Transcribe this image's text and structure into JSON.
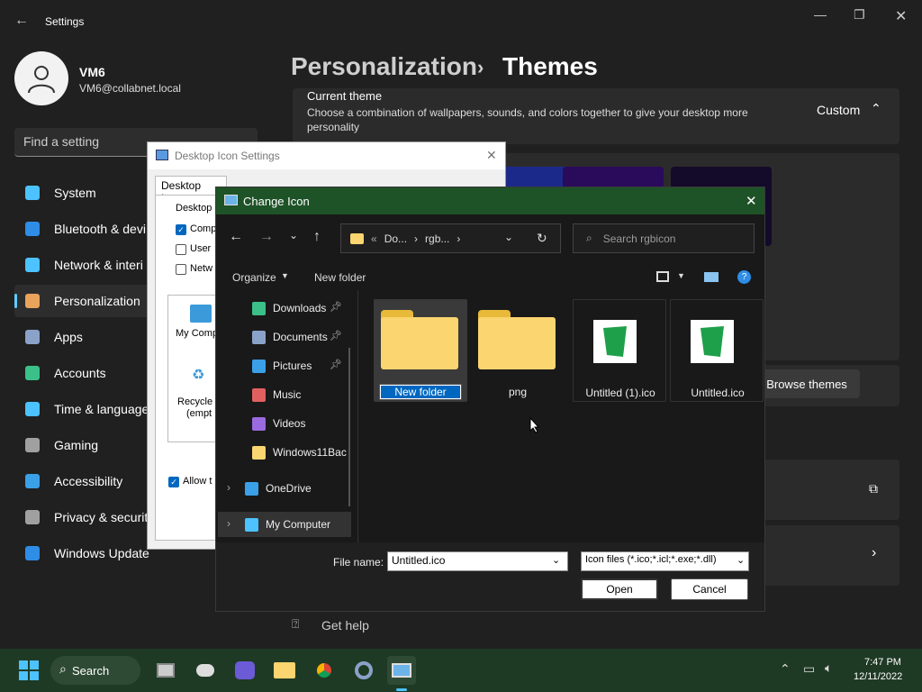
{
  "settings": {
    "title": "Settings",
    "user": {
      "name": "VM6",
      "email": "VM6@collabnet.local"
    },
    "search_placeholder": "Find a setting",
    "nav": [
      {
        "label": "System",
        "color": "#4cc2ff"
      },
      {
        "label": "Bluetooth & devi",
        "color": "#2e8de6"
      },
      {
        "label": "Network & interi",
        "color": "#4cc2ff"
      },
      {
        "label": "Personalization",
        "color": "#e9a35b"
      },
      {
        "label": "Apps",
        "color": "#8aa2c8"
      },
      {
        "label": "Accounts",
        "color": "#3cc08a"
      },
      {
        "label": "Time & language",
        "color": "#4cc2ff"
      },
      {
        "label": "Gaming",
        "color": "#a0a0a0"
      },
      {
        "label": "Accessibility",
        "color": "#3aa0e8"
      },
      {
        "label": "Privacy & security",
        "color": "#a0a0a0"
      },
      {
        "label": "Windows Update",
        "color": "#2e8de6"
      }
    ],
    "breadcrumb": {
      "parent": "Personalization",
      "separator": "›",
      "current": "Themes"
    },
    "current_theme": {
      "heading": "Current theme",
      "description": "Choose a combination of wallpapers, sounds, and colors together to give your desktop more personality",
      "value": "Custom"
    },
    "browse_themes": "Browse themes",
    "get_help": "Get help"
  },
  "desktop_icon_settings": {
    "title": "Desktop Icon Settings",
    "tab": "Desktop Icons",
    "group_label": "Desktop i",
    "checkboxes": [
      {
        "label": "Comp",
        "checked": true
      },
      {
        "label": "User",
        "checked": false
      },
      {
        "label": "Netw",
        "checked": false
      }
    ],
    "icons": [
      "My Comp",
      "Recycle",
      "(empt"
    ],
    "allow_label": "Allow t",
    "allow_checked": true
  },
  "change_icon": {
    "title": "Change Icon",
    "address": {
      "prefix": "«",
      "parts": [
        "Do...",
        "rgb..."
      ]
    },
    "search_placeholder": "Search rgbicon",
    "toolbar": {
      "organize": "Organize",
      "new_folder": "New folder"
    },
    "tree": [
      {
        "label": "Downloads",
        "pinned": true,
        "color": "#3cc08a"
      },
      {
        "label": "Documents",
        "pinned": true,
        "color": "#8aa2c8"
      },
      {
        "label": "Pictures",
        "pinned": true,
        "color": "#3aa0e8"
      },
      {
        "label": "Music",
        "pinned": false,
        "color": "#e06060"
      },
      {
        "label": "Videos",
        "pinned": false,
        "color": "#9a6ae0"
      },
      {
        "label": "Windows11Bac",
        "pinned": false,
        "color": "#fbd570"
      },
      {
        "label": "OneDrive",
        "pinned": false,
        "color": "#3aa0e8"
      },
      {
        "label": "My Computer",
        "pinned": false,
        "color": "#4cc2ff"
      }
    ],
    "files": [
      {
        "label": "New folder",
        "type": "folder",
        "editing": true
      },
      {
        "label": "png",
        "type": "folder",
        "editing": false
      },
      {
        "label": "Untitled (1).ico",
        "type": "ico",
        "editing": false
      },
      {
        "label": "Untitled.ico",
        "type": "ico",
        "editing": false
      }
    ],
    "file_name_label": "File name:",
    "file_name_value": "Untitled.ico",
    "file_type": "Icon files (*.ico;*.icl;*.exe;*.dll)",
    "open_label": "Open",
    "cancel_label": "Cancel"
  },
  "taskbar": {
    "search_label": "Search",
    "time": "7:47 PM",
    "date": "12/11/2022"
  }
}
